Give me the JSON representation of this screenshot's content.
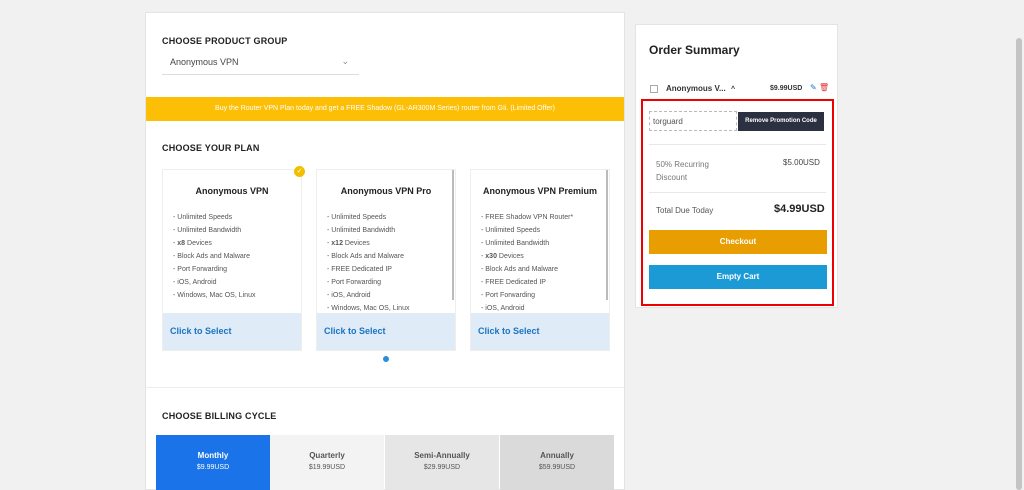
{
  "product_group": {
    "title": "CHOOSE PRODUCT GROUP",
    "selected": "Anonymous VPN"
  },
  "promo_banner": "Buy the Router VPN Plan today and get a FREE Shadow (GL-AR300M Series) router from GIi. (Limited Offer)",
  "plans": {
    "title": "CHOOSE YOUR PLAN",
    "items": [
      {
        "name": "Anonymous VPN",
        "features": [
          "- Unlimited Speeds",
          "- Unlimited Bandwidth",
          "- x8 Devices",
          "- Block Ads and Malware",
          "- Port Forwarding",
          "- iOS, Android",
          "- Windows, Mac OS, Linux"
        ],
        "select_label": "Click to Select",
        "checked": true
      },
      {
        "name": "Anonymous VPN Pro",
        "features": [
          "- Unlimited Speeds",
          "- Unlimited Bandwidth",
          "- x12 Devices",
          "- Block Ads and Malware",
          "- FREE Dedicated IP",
          "- Port Forwarding",
          "- iOS, Android",
          "- Windows, Mac OS, Linux"
        ],
        "select_label": "Click to Select",
        "checked": false
      },
      {
        "name": "Anonymous VPN Premium",
        "features": [
          "- FREE Shadow VPN Router*",
          "- Unlimited Speeds",
          "- Unlimited Bandwidth",
          "- x30 Devices",
          "- Block Ads and Malware",
          "- FREE Dedicated IP",
          "- Port Forwarding",
          "- iOS, Android"
        ],
        "select_label": "Click to Select",
        "checked": false
      }
    ]
  },
  "billing": {
    "title": "CHOOSE BILLING CYCLE",
    "options": [
      {
        "name": "Monthly",
        "price": "$9.99USD"
      },
      {
        "name": "Quarterly",
        "price": "$19.99USD"
      },
      {
        "name": "Semi-Annually",
        "price": "$29.99USD"
      },
      {
        "name": "Annually",
        "price": "$59.99USD"
      }
    ]
  },
  "summary": {
    "title": "Order Summary",
    "item_name": "Anonymous V...",
    "item_caret": "^",
    "item_price": "$9.99USD",
    "promo_code": "torguard",
    "remove_promo_label": "Remove Promotion Code",
    "discount_label": "50% Recurring Discount",
    "discount_value": "$5.00USD",
    "total_label": "Total Due Today",
    "total_value": "$4.99USD",
    "checkout_label": "Checkout",
    "empty_cart_label": "Empty Cart"
  },
  "colors": {
    "accent_blue": "#1a73e8",
    "banner_yellow": "#fcbf06",
    "checkout_orange": "#e89e00",
    "empty_cart_blue": "#1b9ad6",
    "highlight_red": "#e00000"
  }
}
